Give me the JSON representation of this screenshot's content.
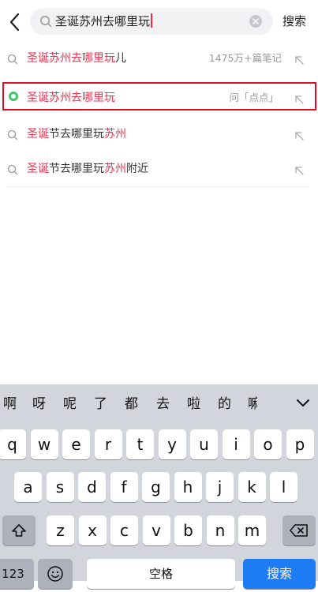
{
  "search": {
    "query": "圣诞苏州去哪里玩",
    "submit_label": "搜索"
  },
  "suggestions": [
    {
      "parts": [
        {
          "t": "圣诞苏州去哪里玩",
          "h": true
        },
        {
          "t": "儿",
          "h": false
        }
      ],
      "meta": "1475万+篇笔记",
      "selected": false,
      "icon": "search-icon"
    },
    {
      "parts": [
        {
          "t": "圣诞苏州去哪里玩",
          "h": true
        }
      ],
      "meta": "问「点点」",
      "selected": true,
      "icon": "ai-dot-icon"
    },
    {
      "parts": [
        {
          "t": "圣诞",
          "h": true
        },
        {
          "t": "节去哪里玩",
          "h": false
        },
        {
          "t": "苏州",
          "h": true
        }
      ],
      "meta": "",
      "selected": false,
      "icon": "search-icon"
    },
    {
      "parts": [
        {
          "t": "圣诞",
          "h": true
        },
        {
          "t": "节去哪里玩",
          "h": false
        },
        {
          "t": "苏州",
          "h": true
        },
        {
          "t": "附近",
          "h": false
        }
      ],
      "meta": "",
      "selected": false,
      "icon": "search-icon"
    }
  ],
  "keyboard": {
    "candidates": [
      "啊",
      "呀",
      "呢",
      "了",
      "都",
      "去",
      "啦",
      "的",
      "嘛"
    ],
    "row1": [
      "q",
      "w",
      "e",
      "r",
      "t",
      "y",
      "u",
      "i",
      "o",
      "p"
    ],
    "row2": [
      "a",
      "s",
      "d",
      "f",
      "g",
      "h",
      "j",
      "k",
      "l"
    ],
    "row3": [
      "z",
      "x",
      "c",
      "v",
      "b",
      "n",
      "m"
    ],
    "numbers_label": "123",
    "space_label": "空格",
    "go_label": "搜索"
  },
  "colors": {
    "highlight": "#e8334f",
    "go": "#1e7cf5",
    "selection_border": "#e01020"
  }
}
